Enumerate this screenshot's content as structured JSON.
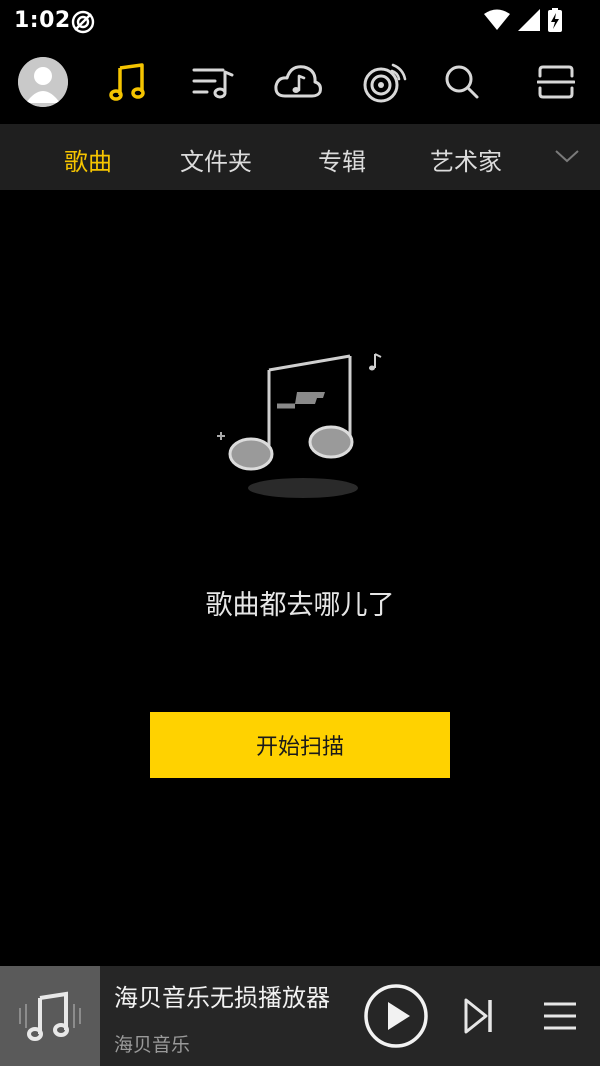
{
  "status": {
    "time": "1:02"
  },
  "nav": {
    "icons": [
      "avatar-icon",
      "music-note-icon",
      "playlist-icon",
      "cloud-music-icon",
      "radio-icon",
      "search-icon",
      "scan-icon"
    ]
  },
  "tabs": [
    {
      "label": "歌曲",
      "active": true
    },
    {
      "label": "文件夹",
      "active": false
    },
    {
      "label": "专辑",
      "active": false
    },
    {
      "label": "艺术家",
      "active": false
    }
  ],
  "empty": {
    "message": "歌曲都去哪儿了",
    "button_label": "开始扫描"
  },
  "player": {
    "title": "海贝音乐无损播放器",
    "artist": "海贝音乐"
  },
  "colors": {
    "accent": "#f5c400",
    "button": "#ffd200",
    "background": "#000000",
    "tab_bar": "#1f1f1f",
    "player_bar": "#262626"
  }
}
